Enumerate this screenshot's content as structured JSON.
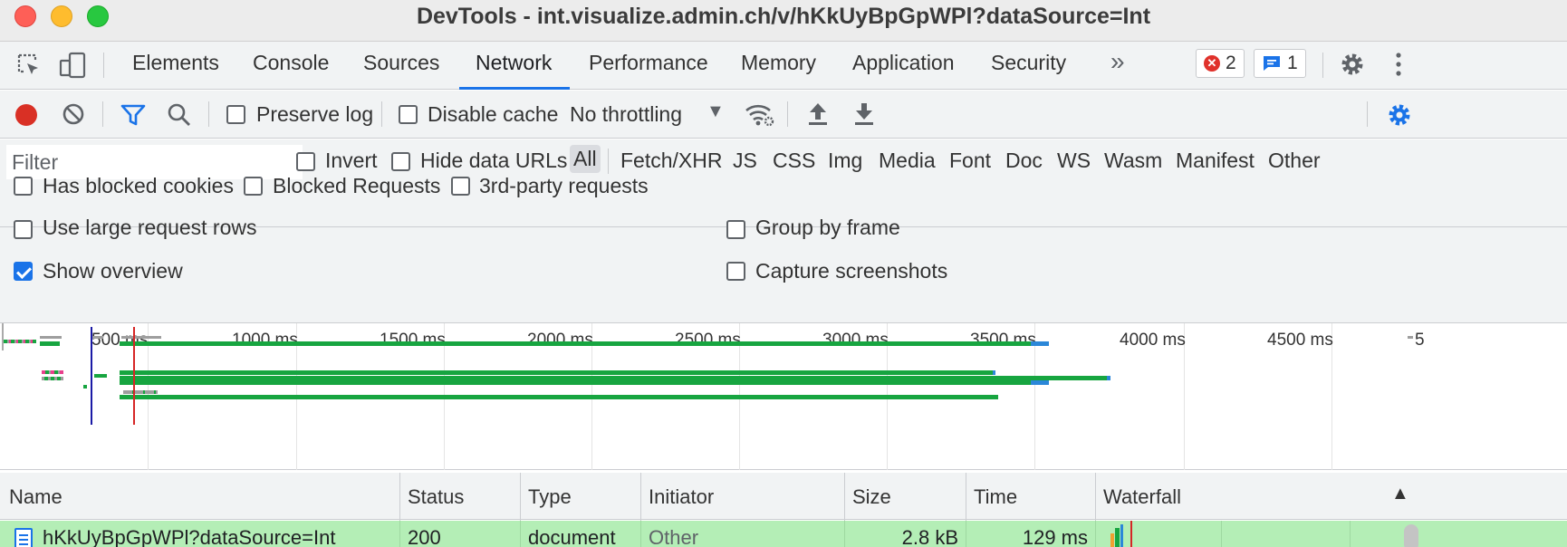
{
  "window": {
    "title": "DevTools - int.visualize.admin.ch/v/hKkUyBpGpWPl?dataSource=Int"
  },
  "tabs": [
    {
      "label": "Elements"
    },
    {
      "label": "Console"
    },
    {
      "label": "Sources"
    },
    {
      "label": "Network",
      "active": true
    },
    {
      "label": "Performance"
    },
    {
      "label": "Memory"
    },
    {
      "label": "Application"
    },
    {
      "label": "Security"
    }
  ],
  "tabbar": {
    "more_icon": "chevron-double-right-icon",
    "errors_count": "2",
    "messages_count": "1"
  },
  "toolbar": {
    "preserve_log": "Preserve log",
    "preserve_log_checked": false,
    "disable_cache": "Disable cache",
    "disable_cache_checked": false,
    "throttling": "No throttling"
  },
  "filter": {
    "placeholder": "Filter",
    "invert": "Invert",
    "hide_data_urls": "Hide data URLs",
    "types": [
      "All",
      "Fetch/XHR",
      "JS",
      "CSS",
      "Img",
      "Media",
      "Font",
      "Doc",
      "WS",
      "Wasm",
      "Manifest",
      "Other"
    ],
    "active_type": "All",
    "has_blocked_cookies": "Has blocked cookies",
    "blocked_requests": "Blocked Requests",
    "third_party": "3rd-party requests"
  },
  "settings": {
    "large_rows": "Use large request rows",
    "large_rows_checked": false,
    "show_overview": "Show overview",
    "show_overview_checked": true,
    "group_by_frame": "Group by frame",
    "group_by_frame_checked": false,
    "capture_screenshots": "Capture screenshots",
    "capture_screenshots_checked": false
  },
  "overview": {
    "ticks": [
      "500 ms",
      "1000 ms",
      "1500 ms",
      "2000 ms",
      "2500 ms",
      "3000 ms",
      "3500 ms",
      "4000 ms",
      "4500 ms",
      "5"
    ]
  },
  "table": {
    "columns": [
      "Name",
      "Status",
      "Type",
      "Initiator",
      "Size",
      "Time",
      "Waterfall"
    ],
    "rows": [
      {
        "name": "hKkUyBpGpWPl?dataSource=Int",
        "status": "200",
        "type": "document",
        "initiator": "Other",
        "size": "2.8 kB",
        "time": "129 ms"
      }
    ]
  },
  "colors": {
    "accent": "#1a73e8",
    "record": "#d93025",
    "row_highlight": "#b4eeb6",
    "bar_green": "#17a540",
    "dom_content_loaded": "#1a1aa6",
    "load_event": "#d62626"
  }
}
